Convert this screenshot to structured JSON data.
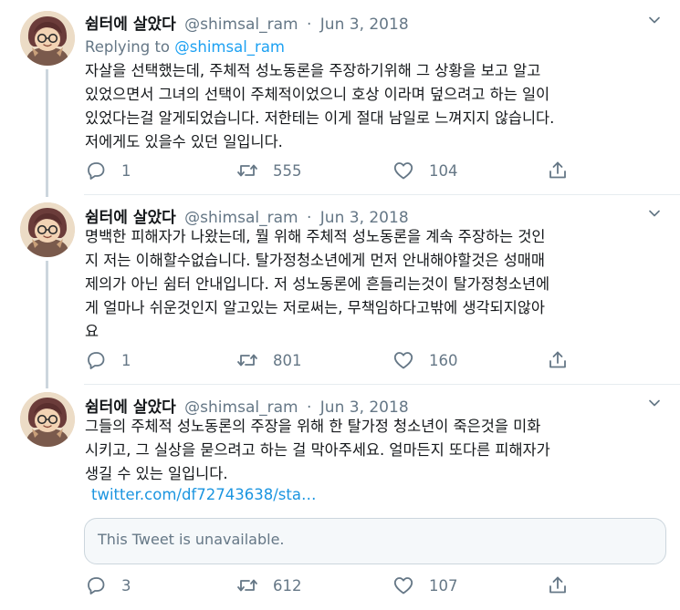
{
  "tweets": [
    {
      "display_name": "쉼터에 살았다",
      "handle": "@shimsal_ram",
      "separator": "·",
      "date": "Jun 3, 2018",
      "replying_prefix": "Replying to ",
      "replying_to": "@shimsal_ram",
      "text": "자살을 선택했는데, 주체적 성노동론을 주장하기위해 그 상황을 보고 알고\n있었으면서 그녀의 선택이 주체적이었으니 호상 이라며 덮으려고 하는 일이\n있었다는걸 알게되었습니다. 저한테는 이게 절대 남일로 느껴지지 않습니다.\n저에게도 있을수 있던 일입니다.",
      "replies": "1",
      "retweets": "555",
      "likes": "104"
    },
    {
      "display_name": "쉼터에 살았다",
      "handle": "@shimsal_ram",
      "separator": "·",
      "date": "Jun 3, 2018",
      "text": "명백한 피해자가 나왔는데, 뭘 위해 주체적 성노동론을 계속 주장하는 것인\n지 저는 이해할수없습니다. 탈가정청소년에게 먼저 안내해야할것은 성매매\n제의가 아닌 쉼터 안내입니다. 저 성노동론에 흔들리는것이 탈가정청소년에\n게 얼마나 쉬운것인지 알고있는 저로써는, 무책임하다고밖에 생각되지않아\n요",
      "replies": "1",
      "retweets": "801",
      "likes": "160"
    },
    {
      "display_name": "쉼터에 살았다",
      "handle": "@shimsal_ram",
      "separator": "·",
      "date": "Jun 3, 2018",
      "text": "그들의 주체적 성노동론의 주장을 위해 한 탈가정 청소년이 죽은것을 미화\n시키고, 그 실상을 묻으려고 하는 걸 막아주세요. 얼마든지 또다른 피해자가\n생길 수 있는 일입니다.",
      "link": "twitter.com/df72743638/sta…",
      "quoted_unavailable": "This Tweet is unavailable.",
      "replies": "3",
      "retweets": "612",
      "likes": "107"
    }
  ],
  "icons": {
    "reply": "reply-icon",
    "retweet": "retweet-icon",
    "like": "heart-icon",
    "share": "share-icon",
    "caret": "chevron-down-icon",
    "avatar": "avatar"
  },
  "colors": {
    "text": "#14171a",
    "secondary": "#657786",
    "link": "#1da1f2",
    "thread_line": "#ccd6dd",
    "divider": "#e6ecf0"
  }
}
